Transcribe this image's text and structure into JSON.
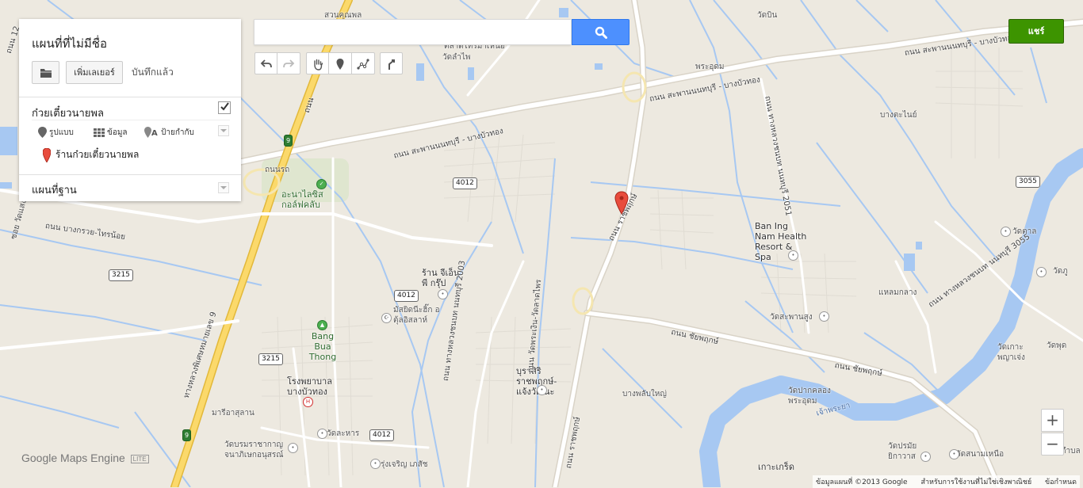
{
  "map": {
    "title": "แผนที่ที่ไม่มีชื่อ",
    "add_layer_label": "เพิ่มเลเยอร์",
    "saved_status": "บันทึกแล้ว",
    "layer": {
      "name": "ก๋วยเตี๋ยวนายพล",
      "checked": true,
      "style_label": "รูปแบบ",
      "data_label": "ข้อมูล",
      "labels_label": "ป้ายกำกับ",
      "feature_label": "ร้านก๋วยเตี๋ยวนายพล"
    },
    "basemap_label": "แผนที่ฐาน"
  },
  "search": {
    "value": "",
    "placeholder": ""
  },
  "share_label": "แชร์",
  "zoom": {
    "in_label": "+",
    "out_label": "−"
  },
  "logo": {
    "google": "Google",
    "product": "Maps Engine",
    "badge": "LITE"
  },
  "attribution": {
    "data": "ข้อมูลแผนที่ ©2013 Google",
    "noncommercial": "สำหรับการใช้งานที่ไม่ใช่เชิงพาณิชย์",
    "terms": "ข้อกำหนด"
  },
  "map_labels": {
    "suan_khun_phon": "สวนคุณพล",
    "wat_lam_phai": "วัดลำไพ",
    "ta_sai_ma": "ตลาดไทรมาเหนือ",
    "pra_udom": "พระอุดม",
    "wat_bin": "วัดบิน",
    "bang_tanai": "บางตะไนย์",
    "road_sapan_top": "ถนน สะพานนนทบุรี - บางบัวทอง",
    "road_sapan_mid": "ถนน สะพานนนทบุรี - บางบัวทอง",
    "road_sapan_left": "ถนน สะพานนนทบุรี - บางบัวทอง",
    "highway_nonthaburi": "ถนน ทางหลวงชนบท นนทบุรี 2051",
    "road_ratchapruek": "ถนน ราชพฤกษ์",
    "road_ratchapruek2": "ถนน ราชพฤกษ์",
    "road_chaiyaphruek": "ถนน ชัยพฤกษ์",
    "road_chaiyaphruek2": "ถนน ชัยพฤกษ์",
    "highway_9": "ทางหลวงพิเศษหมายเลข 9",
    "highway_9b": "ถนน",
    "thanon_krit": "ถนนรถ",
    "alai_golf": "อะนาไลซิส กอล์ฟคลับ",
    "ban_ing": "Ban Ing Nam Health Resort & Spa",
    "wat_tal": "วัดตาล",
    "wat_phu": "วัดภู",
    "wat_saphan_sung": "วัดสะพานสูง",
    "wat_ko": "วัดเกาะ พญาเจ่ง",
    "wat_phut": "วัดพุด",
    "pak_khlong": "วัดปากคลอง พระอุดม",
    "jao_phraya": "เจ้าพระยา",
    "ko_kret": "เกาะเกร็ด",
    "wat_pramai": "วัดปรมัย ยิกาวาส",
    "wat_sanam": "วัดสนามเหนือ",
    "tambon": "ตำบล",
    "rang_jie": "ร้าน จีเอ็น พี กรุ๊ป",
    "masjid": "มัสยิดนีะฮิ๊ก อตุ้ลอิสลาห์",
    "bang_bua_thong": "Bang Bua Thong",
    "buri_siri": "บุราสิริ ราชพฤกษ์-แจ้งวัฒนะ",
    "bang_phlap": "บางพลับใหญ่",
    "hospital": "โรงพยาบาล บางบัวทอง",
    "marisha": "มารีอาสุลาน",
    "wat_lahan": "วัดละหาร",
    "wat_bor": "วัดบรมราชากาญ จนาภิเษกอนุสรณ์",
    "rung_charoen": "รุ่งเจริญ เภสัช",
    "bang_kruai": "ถนน บางกรวย-ไทรน้อย",
    "soi": "ซอย วัดแสงใหญ่",
    "road_2003": "ถนน ทางหลวงชนบท นนทบุรี 2003",
    "road_wat_phrat": "ถนน วัดพระเงิน-วัดลาดไพร",
    "road_3055": "ถนน ทางหลวงชนบท นนทบุรี 3055",
    "khlong": "แหลมกลาง",
    "road_12": "ถนน 12",
    "soi_laem": "ซอย ลำบางคูวัด",
    "road_chaiyaphruek_3": "ถนน ชัยพฤกษ์"
  },
  "shields": {
    "s4012a": "4012",
    "s4012b": "4012",
    "s4012c": "4012",
    "s3215a": "3215",
    "s3215b": "3215",
    "s3055": "3055",
    "s9a": "9",
    "s9b": "9"
  }
}
